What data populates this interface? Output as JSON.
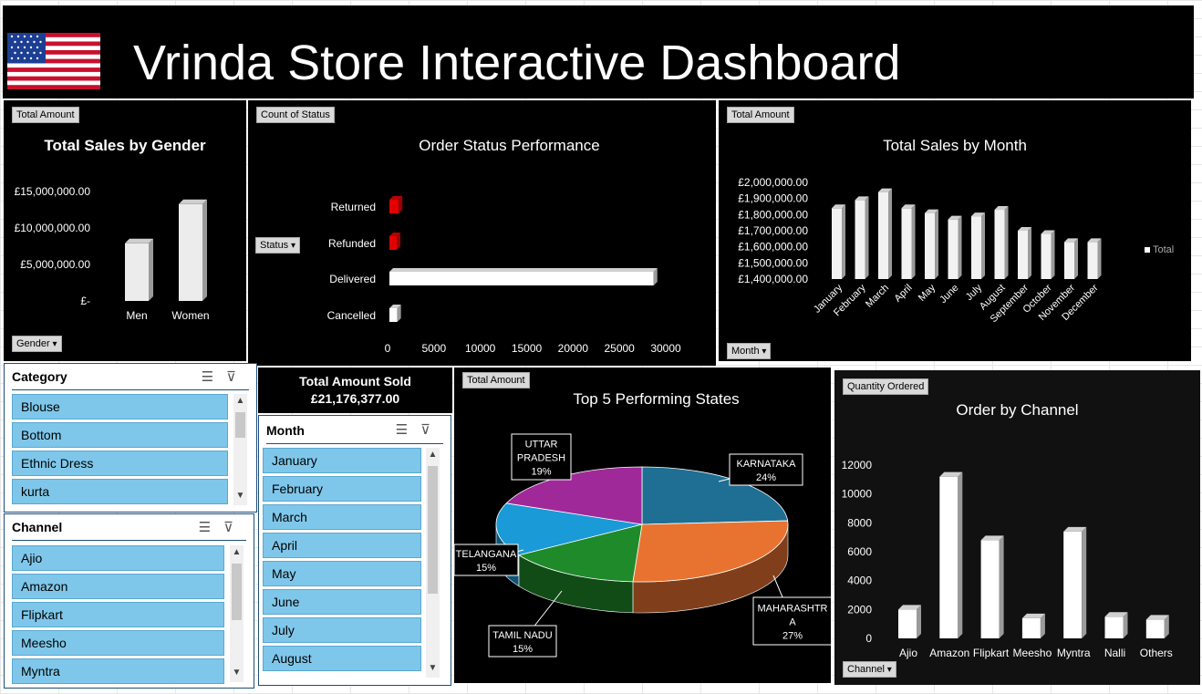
{
  "header": {
    "title": "Vrinda Store Interactive Dashboard",
    "flag_icon": "us-flag-icon"
  },
  "gender_chart": {
    "field_button": "Total Amount",
    "filter_button": "Gender",
    "chart_data": {
      "type": "bar",
      "title": "Total Sales by Gender",
      "categories": [
        "Men",
        "Women"
      ],
      "values": [
        7900000,
        13276377
      ],
      "ylim": [
        0,
        15000000
      ],
      "yticks": [
        "£15,000,000.00",
        "£10,000,000.00",
        "£5,000,000.00",
        "£-"
      ],
      "ytick_values": [
        15000000,
        10000000,
        5000000,
        0
      ]
    }
  },
  "status_chart": {
    "field_button": "Count of Status",
    "filter_button": "Status",
    "chart_data": {
      "type": "bar",
      "orientation": "horizontal",
      "title": "Order Status Performance",
      "categories": [
        "Returned",
        "Refunded",
        "Delivered",
        "Cancelled"
      ],
      "values": [
        1000,
        700,
        28500,
        850
      ],
      "colors": [
        "#e00000",
        "#e00000",
        "#ffffff",
        "#ffffff"
      ],
      "xlim": [
        0,
        30000
      ],
      "xticks": [
        "0",
        "5000",
        "10000",
        "15000",
        "20000",
        "25000",
        "30000"
      ],
      "xtick_values": [
        0,
        5000,
        10000,
        15000,
        20000,
        25000,
        30000
      ]
    }
  },
  "month_chart": {
    "field_button": "Total Amount",
    "filter_button": "Month",
    "legend": "Total",
    "chart_data": {
      "type": "bar",
      "title": "Total Sales by Month",
      "categories": [
        "January",
        "February",
        "March",
        "April",
        "May",
        "June",
        "July",
        "August",
        "September",
        "October",
        "November",
        "December"
      ],
      "values": [
        1840000,
        1890000,
        1940000,
        1840000,
        1810000,
        1770000,
        1790000,
        1830000,
        1700000,
        1680000,
        1630000,
        1630000
      ],
      "ylim": [
        1400000,
        2000000
      ],
      "yticks": [
        "£2,000,000.00",
        "£1,900,000.00",
        "£1,800,000.00",
        "£1,700,000.00",
        "£1,600,000.00",
        "£1,500,000.00",
        "£1,400,000.00"
      ],
      "ytick_values": [
        2000000,
        1900000,
        1800000,
        1700000,
        1600000,
        1500000,
        1400000
      ]
    }
  },
  "total_sold": {
    "label": "Total Amount Sold",
    "value": "£21,176,377.00"
  },
  "states_chart": {
    "field_button": "Total Amount",
    "chart_data": {
      "type": "pie",
      "title": "Top 5 Performing States",
      "slices": [
        {
          "label_lines": [
            "KARNATAKA",
            "24%"
          ],
          "value": 24,
          "color": "#1f6e93"
        },
        {
          "label_lines": [
            "MAHARASHTR",
            "A",
            "27%"
          ],
          "value": 27,
          "color": "#e87330"
        },
        {
          "label_lines": [
            "TAMIL NADU",
            "15%"
          ],
          "value": 15,
          "color": "#1f8a2a"
        },
        {
          "label_lines": [
            "TELANGANA",
            "15%"
          ],
          "value": 15,
          "color": "#1a9ad6"
        },
        {
          "label_lines": [
            "UTTAR",
            "PRADESH",
            "19%"
          ],
          "value": 19,
          "color": "#a0299a"
        }
      ]
    }
  },
  "channel_chart": {
    "field_button": "Quantity Ordered",
    "filter_button": "Channel",
    "chart_data": {
      "type": "bar",
      "title": "Order by Channel",
      "categories": [
        "Ajio",
        "Amazon",
        "Flipkart",
        "Meesho",
        "Myntra",
        "Nalli",
        "Others"
      ],
      "values": [
        2000,
        11200,
        6800,
        1400,
        7400,
        1500,
        1300
      ],
      "ylim": [
        0,
        12000
      ],
      "yticks": [
        "12000",
        "10000",
        "8000",
        "6000",
        "4000",
        "2000",
        "0"
      ],
      "ytick_values": [
        12000,
        10000,
        8000,
        6000,
        4000,
        2000,
        0
      ]
    }
  },
  "category_slicer": {
    "title": "Category",
    "items": [
      "Blouse",
      "Bottom",
      "Ethnic Dress",
      "kurta"
    ]
  },
  "channel_slicer": {
    "title": "Channel",
    "items": [
      "Ajio",
      "Amazon",
      "Flipkart",
      "Meesho",
      "Myntra"
    ]
  },
  "month_slicer": {
    "title": "Month",
    "items": [
      "January",
      "February",
      "March",
      "April",
      "May",
      "June",
      "July",
      "August"
    ]
  }
}
